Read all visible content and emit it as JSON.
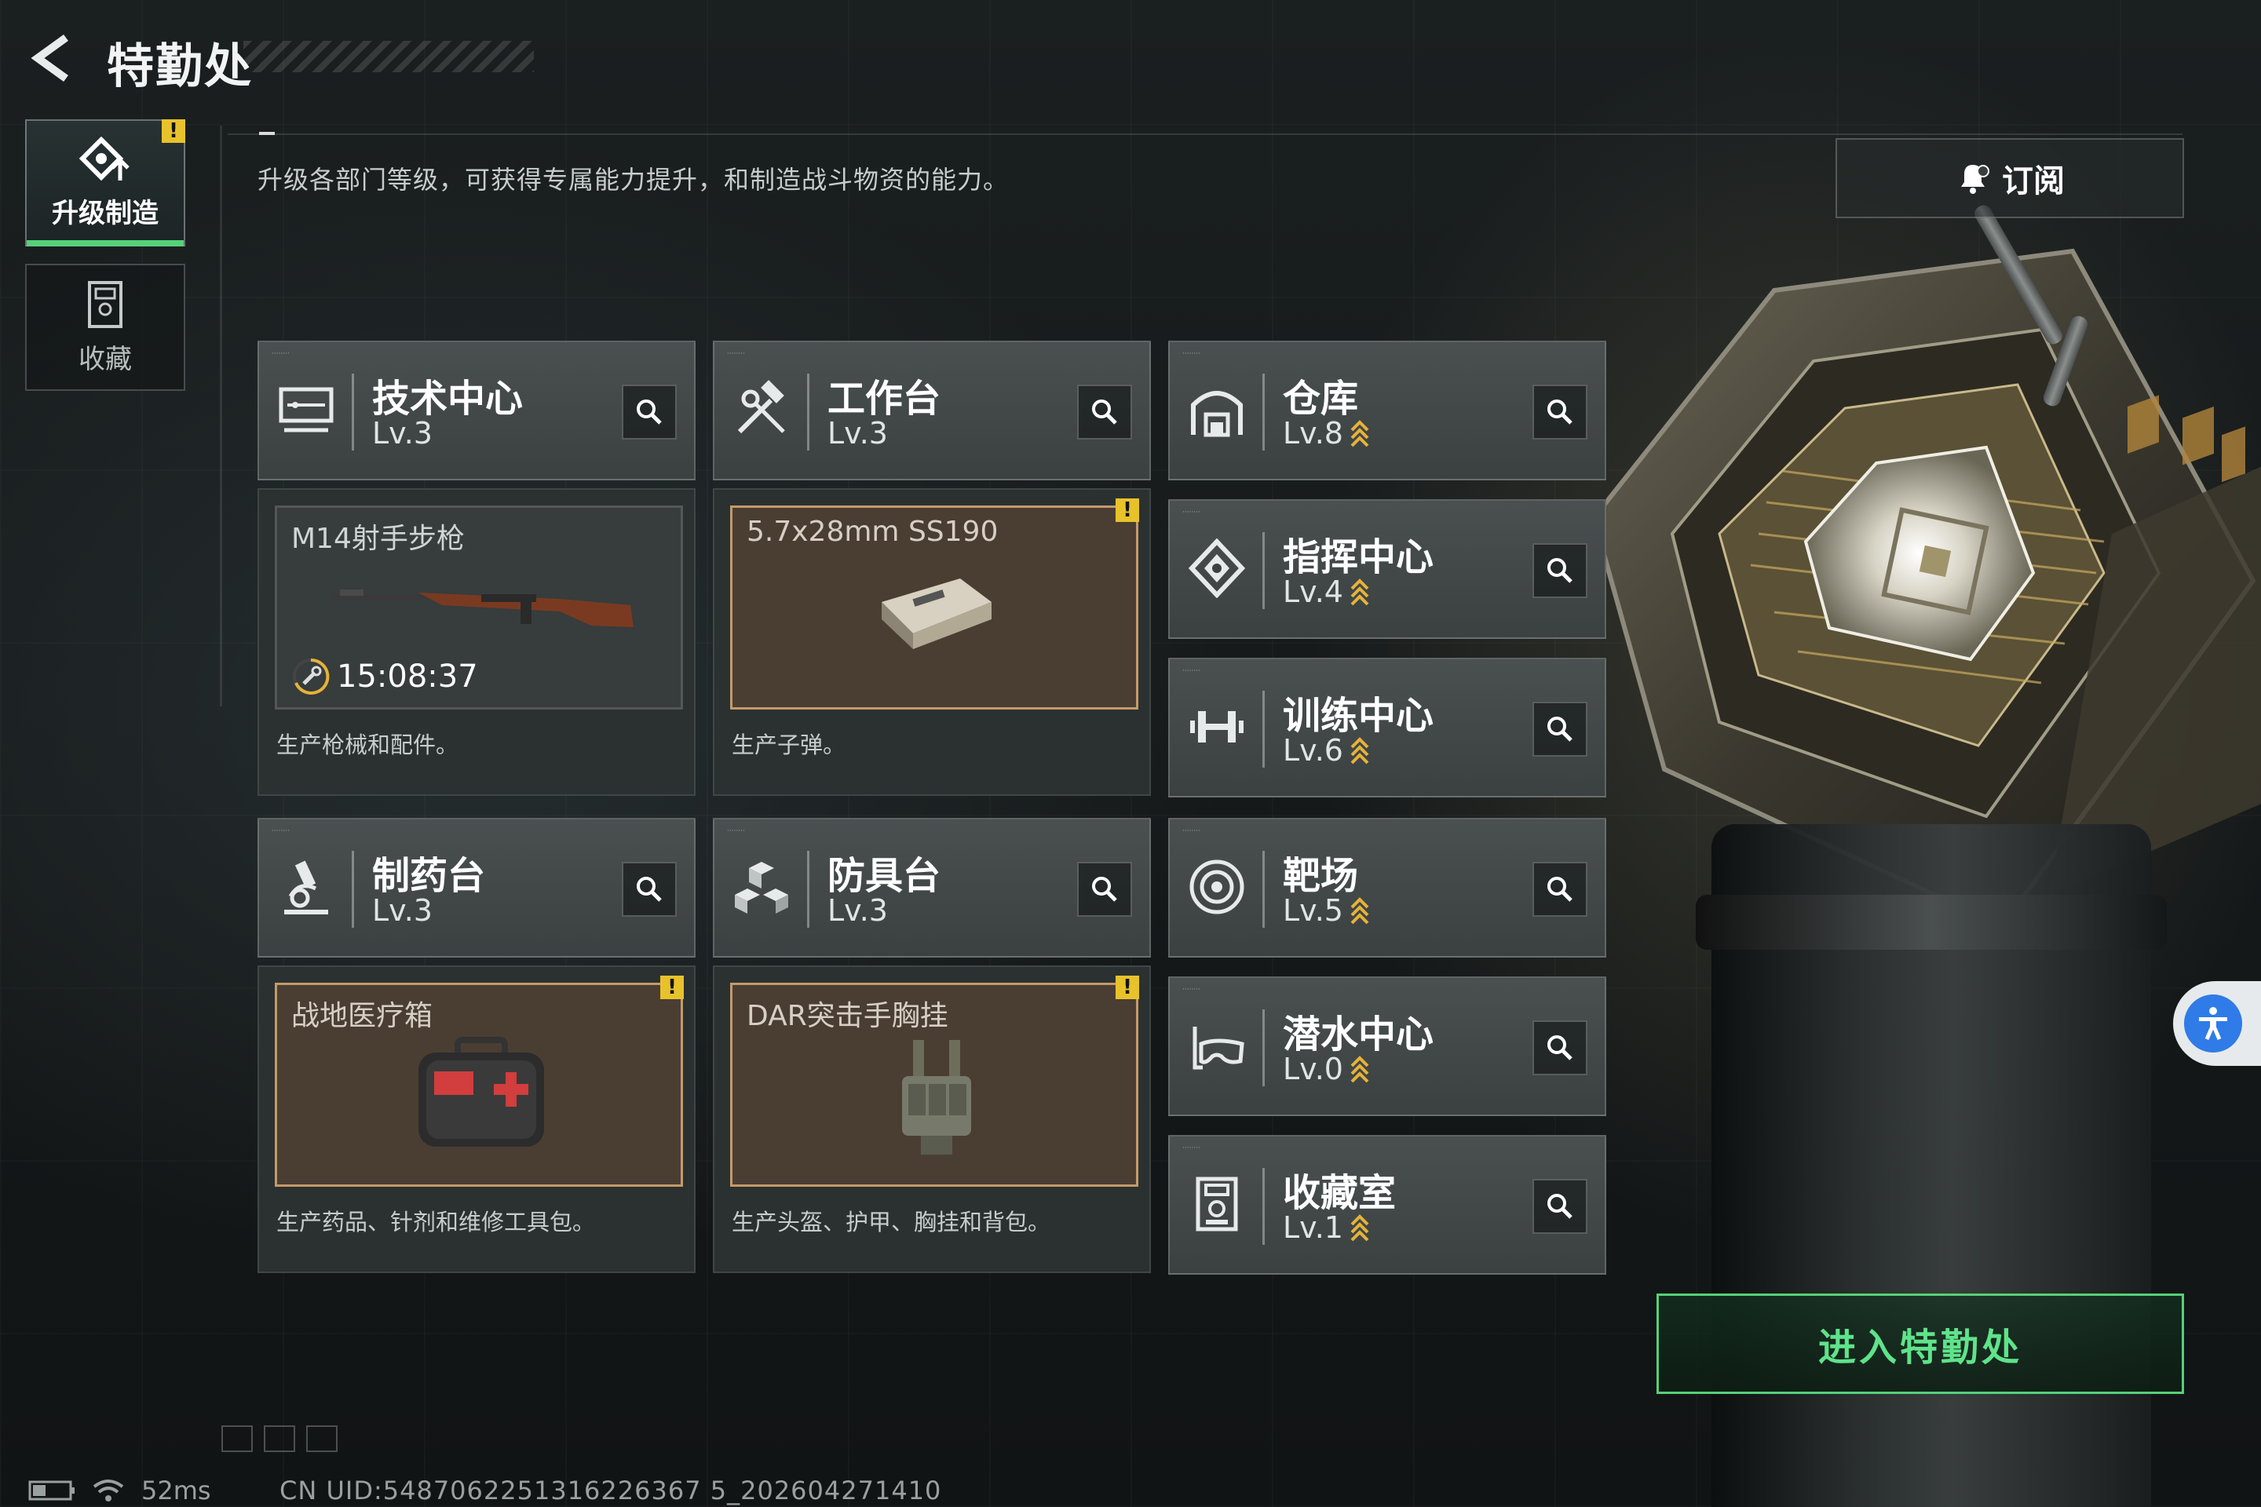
{
  "header": {
    "title": "特勤处",
    "back_icon": "back-arrow-icon"
  },
  "nav": [
    {
      "label": "升级制造",
      "icon": "upgrade-icon",
      "active": true,
      "alert": "!"
    },
    {
      "label": "收藏",
      "icon": "collection-icon",
      "active": false
    }
  ],
  "description": "升级各部门等级，可获得专属能力提升，和制造战斗物资的能力。",
  "subscribe": {
    "label": "订阅",
    "icon": "bell-icon"
  },
  "workshops": [
    {
      "name": "技术中心",
      "level": "Lv.3",
      "icon": "monitor-icon",
      "product": {
        "name": "M14射手步枪",
        "timer": "15:08:37",
        "state": "producing",
        "image": "rifle-icon"
      },
      "desc": "生产枪械和配件。"
    },
    {
      "name": "工作台",
      "level": "Lv.3",
      "icon": "tools-icon",
      "product": {
        "name": "5.7x28mm SS190",
        "state": "done",
        "image": "ammo-box-icon",
        "alert": "!"
      },
      "desc": "生产子弹。"
    },
    {
      "name": "制药台",
      "level": "Lv.3",
      "icon": "microscope-icon",
      "product": {
        "name": "战地医疗箱",
        "state": "done",
        "image": "medkit-icon",
        "alert": "!"
      },
      "desc": "生产药品、针剂和维修工具包。"
    },
    {
      "name": "防具台",
      "level": "Lv.3",
      "icon": "armor-blocks-icon",
      "product": {
        "name": "DAR突击手胸挂",
        "state": "done",
        "image": "chest-rig-icon",
        "alert": "!"
      },
      "desc": "生产头盔、护甲、胸挂和背包。"
    }
  ],
  "facilities": [
    {
      "name": "仓库",
      "level": "Lv.8",
      "icon": "warehouse-icon",
      "upgradable": true
    },
    {
      "name": "指挥中心",
      "level": "Lv.4",
      "icon": "command-icon",
      "upgradable": true
    },
    {
      "name": "训练中心",
      "level": "Lv.6",
      "icon": "dumbbell-icon",
      "upgradable": true
    },
    {
      "name": "靶场",
      "level": "Lv.5",
      "icon": "target-icon",
      "upgradable": true
    },
    {
      "name": "潜水中心",
      "level": "Lv.0",
      "icon": "diving-mask-icon",
      "upgradable": true
    },
    {
      "name": "收藏室",
      "level": "Lv.1",
      "icon": "collection-room-icon",
      "upgradable": true
    }
  ],
  "enter_button": {
    "label": "进入特勤处"
  },
  "status_bar": {
    "ping": "52ms",
    "uid": "CN UID:5487062251316226367 5_202604271410"
  },
  "colors": {
    "accent_green": "#56d07a",
    "alert_yellow": "#e8c22b",
    "upgrade_gold": "#e5b23a",
    "done_border": "#c49a6a"
  }
}
